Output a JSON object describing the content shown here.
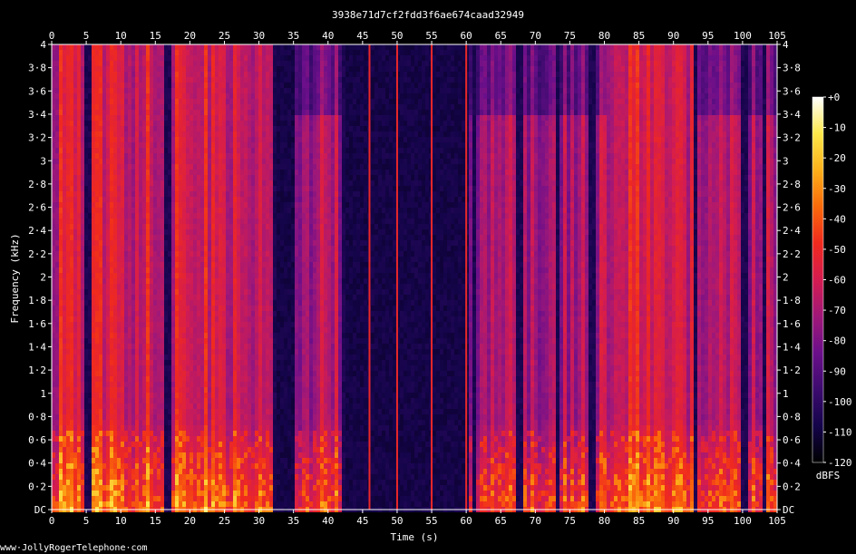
{
  "chart_data": {
    "type": "heatmap",
    "title": "3938e71d7cf2fdd3f6ae674caad32949",
    "xlabel": "Time (s)",
    "ylabel": "Frequency (kHz)",
    "xlim": [
      0,
      105
    ],
    "ylim": [
      0,
      4
    ],
    "x_ticks": [
      0,
      5,
      10,
      15,
      20,
      25,
      30,
      35,
      40,
      45,
      50,
      55,
      60,
      65,
      70,
      75,
      80,
      85,
      90,
      95,
      100,
      105
    ],
    "y_ticks": [
      {
        "value": 0,
        "label": "DC"
      },
      {
        "value": 0.2,
        "label": "0·2"
      },
      {
        "value": 0.4,
        "label": "0·4"
      },
      {
        "value": 0.6,
        "label": "0·6"
      },
      {
        "value": 0.8,
        "label": "0·8"
      },
      {
        "value": 1,
        "label": "1"
      },
      {
        "value": 1.2,
        "label": "1·2"
      },
      {
        "value": 1.4,
        "label": "1·4"
      },
      {
        "value": 1.6,
        "label": "1·6"
      },
      {
        "value": 1.8,
        "label": "1·8"
      },
      {
        "value": 2,
        "label": "2"
      },
      {
        "value": 2.2,
        "label": "2·2"
      },
      {
        "value": 2.4,
        "label": "2·4"
      },
      {
        "value": 2.6,
        "label": "2·6"
      },
      {
        "value": 2.8,
        "label": "2·8"
      },
      {
        "value": 3,
        "label": "3"
      },
      {
        "value": 3.2,
        "label": "3·2"
      },
      {
        "value": 3.4,
        "label": "3·4"
      },
      {
        "value": 3.6,
        "label": "3·6"
      },
      {
        "value": 3.8,
        "label": "3·8"
      },
      {
        "value": 4,
        "label": "4"
      }
    ],
    "colorbar": {
      "label": "dBFS",
      "range": [
        -120,
        0
      ],
      "ticks": [
        {
          "value": 0,
          "label": "+0"
        },
        {
          "value": -10,
          "label": "-10"
        },
        {
          "value": -20,
          "label": "-20"
        },
        {
          "value": -30,
          "label": "-30"
        },
        {
          "value": -40,
          "label": "-40"
        },
        {
          "value": -50,
          "label": "-50"
        },
        {
          "value": -60,
          "label": "-60"
        },
        {
          "value": -70,
          "label": "-70"
        },
        {
          "value": -80,
          "label": "-80"
        },
        {
          "value": -90,
          "label": "-90"
        },
        {
          "value": -100,
          "label": "-100"
        },
        {
          "value": -110,
          "label": "-110"
        },
        {
          "value": -120,
          "label": "-120"
        }
      ],
      "colors": [
        "#000000",
        "#14044a",
        "#3c0b6e",
        "#6b0f8a",
        "#a01878",
        "#d41c50",
        "#f02a1e",
        "#fa6a0a",
        "#fcb01a",
        "#fde84a",
        "#ffffff"
      ]
    },
    "segments": [
      {
        "start": 0,
        "end": 32,
        "level": "loud"
      },
      {
        "start": 32,
        "end": 35,
        "level": "silence"
      },
      {
        "start": 35,
        "end": 42,
        "level": "medium"
      },
      {
        "start": 42,
        "end": 60,
        "level": "silence_with_clicks"
      },
      {
        "start": 60,
        "end": 80,
        "level": "medium"
      },
      {
        "start": 80,
        "end": 93,
        "level": "loud"
      },
      {
        "start": 93,
        "end": 105,
        "level": "medium"
      }
    ],
    "clicks": [
      46,
      50,
      55,
      60
    ],
    "gaps": [
      5,
      16.5,
      32,
      42,
      61,
      67.5,
      73,
      78,
      93,
      100,
      103
    ]
  },
  "watermark": "www·JollyRogerTelephone·com"
}
